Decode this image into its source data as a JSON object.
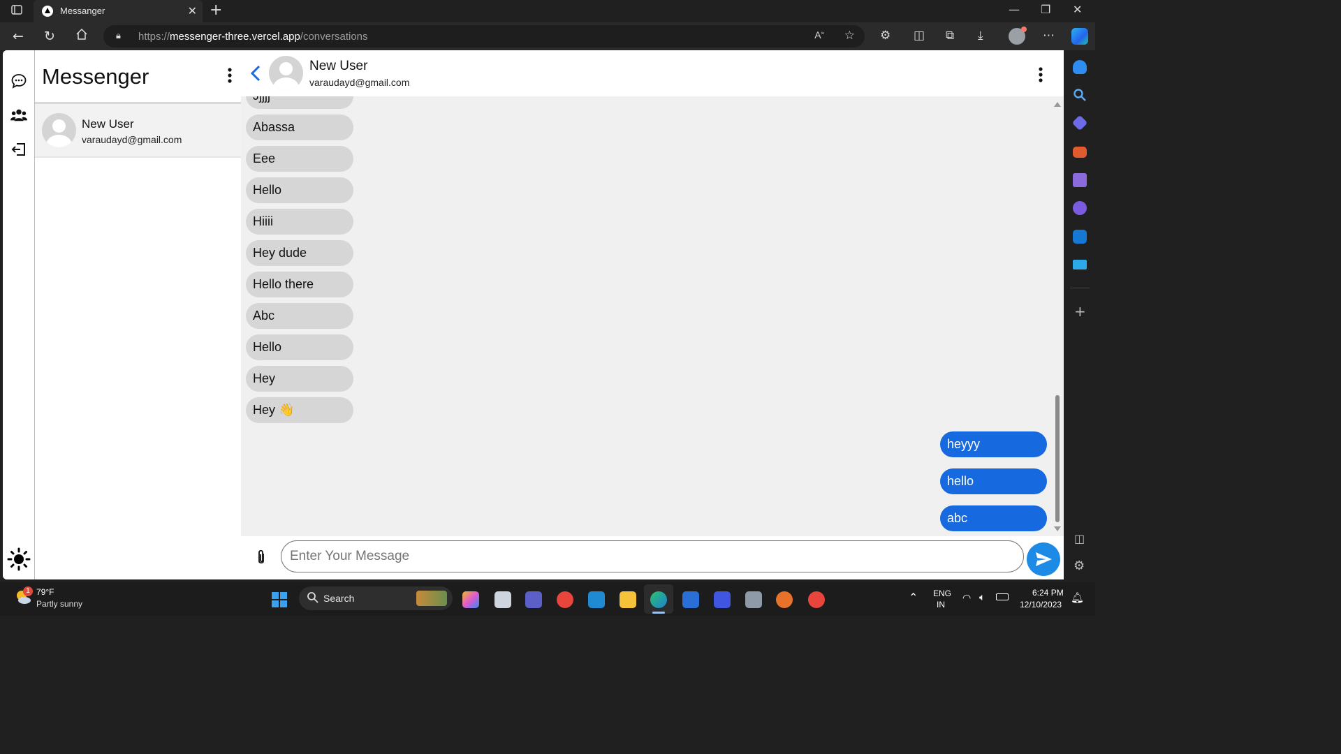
{
  "browser": {
    "tab_title": "Messanger",
    "url_prefix": "https://",
    "url_host": "messenger-three.vercel.app",
    "url_path": "/conversations"
  },
  "sidebar": {
    "app_title": "Messenger"
  },
  "conversations": [
    {
      "name": "New User",
      "email": "varaudayd@gmail.com"
    }
  ],
  "chat": {
    "header": {
      "name": "New User",
      "email": "varaudayd@gmail.com"
    },
    "incoming": [
      "Jjjjj",
      "Abassa",
      "Eee",
      "Hello",
      "Hiiii",
      "Hey dude",
      "Hello there",
      "Abc",
      "Hello",
      "Hey",
      "Hey 👋"
    ],
    "outgoing": [
      "heyyy",
      "hello",
      "abc"
    ],
    "input_placeholder": "Enter Your Message"
  },
  "taskbar": {
    "weather_temp": "79°F",
    "weather_desc": "Partly sunny",
    "weather_badge": "1",
    "search_label": "Search",
    "lang_top": "ENG",
    "lang_bottom": "IN",
    "time": "6:24 PM",
    "date": "12/10/2023"
  },
  "colors": {
    "outgoing_bubble": "#1769e0",
    "incoming_bubble": "#d6d6d6",
    "send_button": "#1d8ae6",
    "back_chevron": "#1769e0"
  }
}
